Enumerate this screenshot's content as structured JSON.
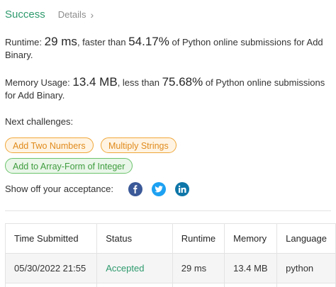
{
  "header": {
    "status": "Success",
    "details_label": "Details",
    "details_icon": "chevron-right-icon"
  },
  "runtime": {
    "prefix": "Runtime: ",
    "value": "29 ms",
    "middle": ", faster than ",
    "percent": "54.17%",
    "suffix_line1": " of Python online submissions for Add",
    "suffix_line2": "Binary."
  },
  "memory": {
    "prefix": "Memory Usage: ",
    "value": "13.4 MB",
    "middle": ", less than ",
    "percent": "75.68%",
    "suffix_line1": " of Python online submissions",
    "suffix_line2": "for Add Binary."
  },
  "next_challenges": {
    "label": "Next challenges:",
    "items": [
      {
        "label": "Add Two Numbers",
        "color": "#f0a73a"
      },
      {
        "label": "Multiply Strings",
        "color": "#f0a73a"
      },
      {
        "label": "Add to Array-Form of Integer",
        "color": "#6cc36c"
      }
    ]
  },
  "share": {
    "label": "Show off your acceptance:",
    "icons": [
      {
        "name": "facebook-icon",
        "color": "#3b5998"
      },
      {
        "name": "twitter-icon",
        "color": "#1da1f2"
      },
      {
        "name": "linkedin-icon",
        "color": "#0e76a8"
      }
    ]
  },
  "table": {
    "headers": [
      "Time Submitted",
      "Status",
      "Runtime",
      "Memory",
      "Language"
    ],
    "rows": [
      [
        "05/30/2022 21:55",
        "Accepted",
        "29 ms",
        "13.4 MB",
        "python"
      ]
    ]
  }
}
